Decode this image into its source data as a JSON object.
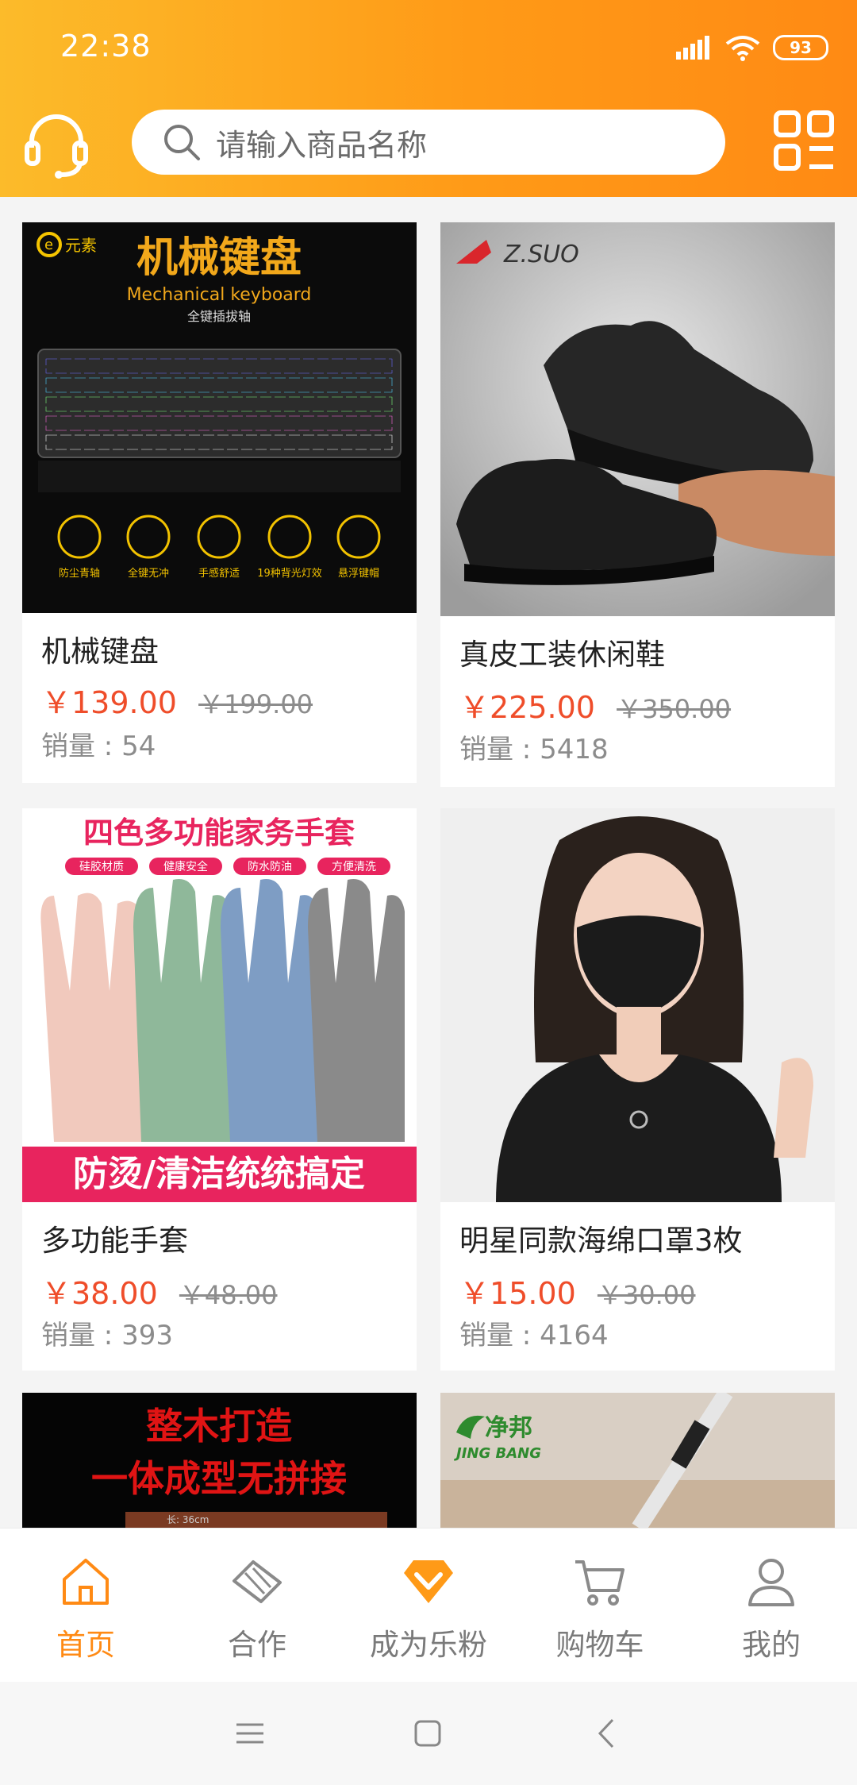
{
  "status": {
    "time": "22:38",
    "battery": "93"
  },
  "header": {
    "search_placeholder": "请输入商品名称",
    "icons": {
      "service": "headset-icon",
      "search": "search-icon",
      "scan": "scan-icon"
    }
  },
  "products": [
    {
      "title": "机械键盘",
      "price": "￥139.00",
      "orig_price": "￥199.00",
      "sales": "销量 : 54"
    },
    {
      "title": "真皮工装休闲鞋",
      "price": "￥225.00",
      "orig_price": "￥350.00",
      "sales": "销量 : 5418"
    },
    {
      "title": "多功能手套",
      "price": "￥38.00",
      "orig_price": "￥48.00",
      "sales": "销量 : 393"
    },
    {
      "title": "明星同款海绵口罩3枚",
      "price": "￥15.00",
      "orig_price": "￥30.00",
      "sales": "销量 : 4164"
    }
  ],
  "product_images": {
    "keyboard": {
      "brand": "元素",
      "headline": "机械键盘",
      "subtitle": "Mechanical keyboard",
      "tagline": "全键插拔轴",
      "features": [
        "防尘青轴",
        "全键无冲",
        "手感舒适",
        "19种背光灯效",
        "悬浮键帽"
      ]
    },
    "shoes": {
      "brand": "Z.SUO"
    },
    "gloves": {
      "headline": "四色多功能家务手套",
      "tags": [
        "硅胶材质",
        "健康安全",
        "防水防油",
        "方便清洗"
      ],
      "footer": "防烫/清洁统统搞定"
    },
    "board": {
      "line1": "整木打造",
      "line2": "一体成型无拼接",
      "dimension": "长: 36cm"
    },
    "mop": {
      "brand": "净邦",
      "brand_en": "JING BANG"
    }
  },
  "bottom_nav": [
    {
      "label": "首页",
      "icon": "home-icon",
      "active": true
    },
    {
      "label": "合作",
      "icon": "handshake-icon",
      "active": false
    },
    {
      "label": "成为乐粉",
      "icon": "diamond-icon",
      "active": false
    },
    {
      "label": "购物车",
      "icon": "cart-icon",
      "active": false
    },
    {
      "label": "我的",
      "icon": "user-icon",
      "active": false
    }
  ],
  "colors": {
    "accent": "#ff8a14",
    "price": "#ef4d2a"
  }
}
